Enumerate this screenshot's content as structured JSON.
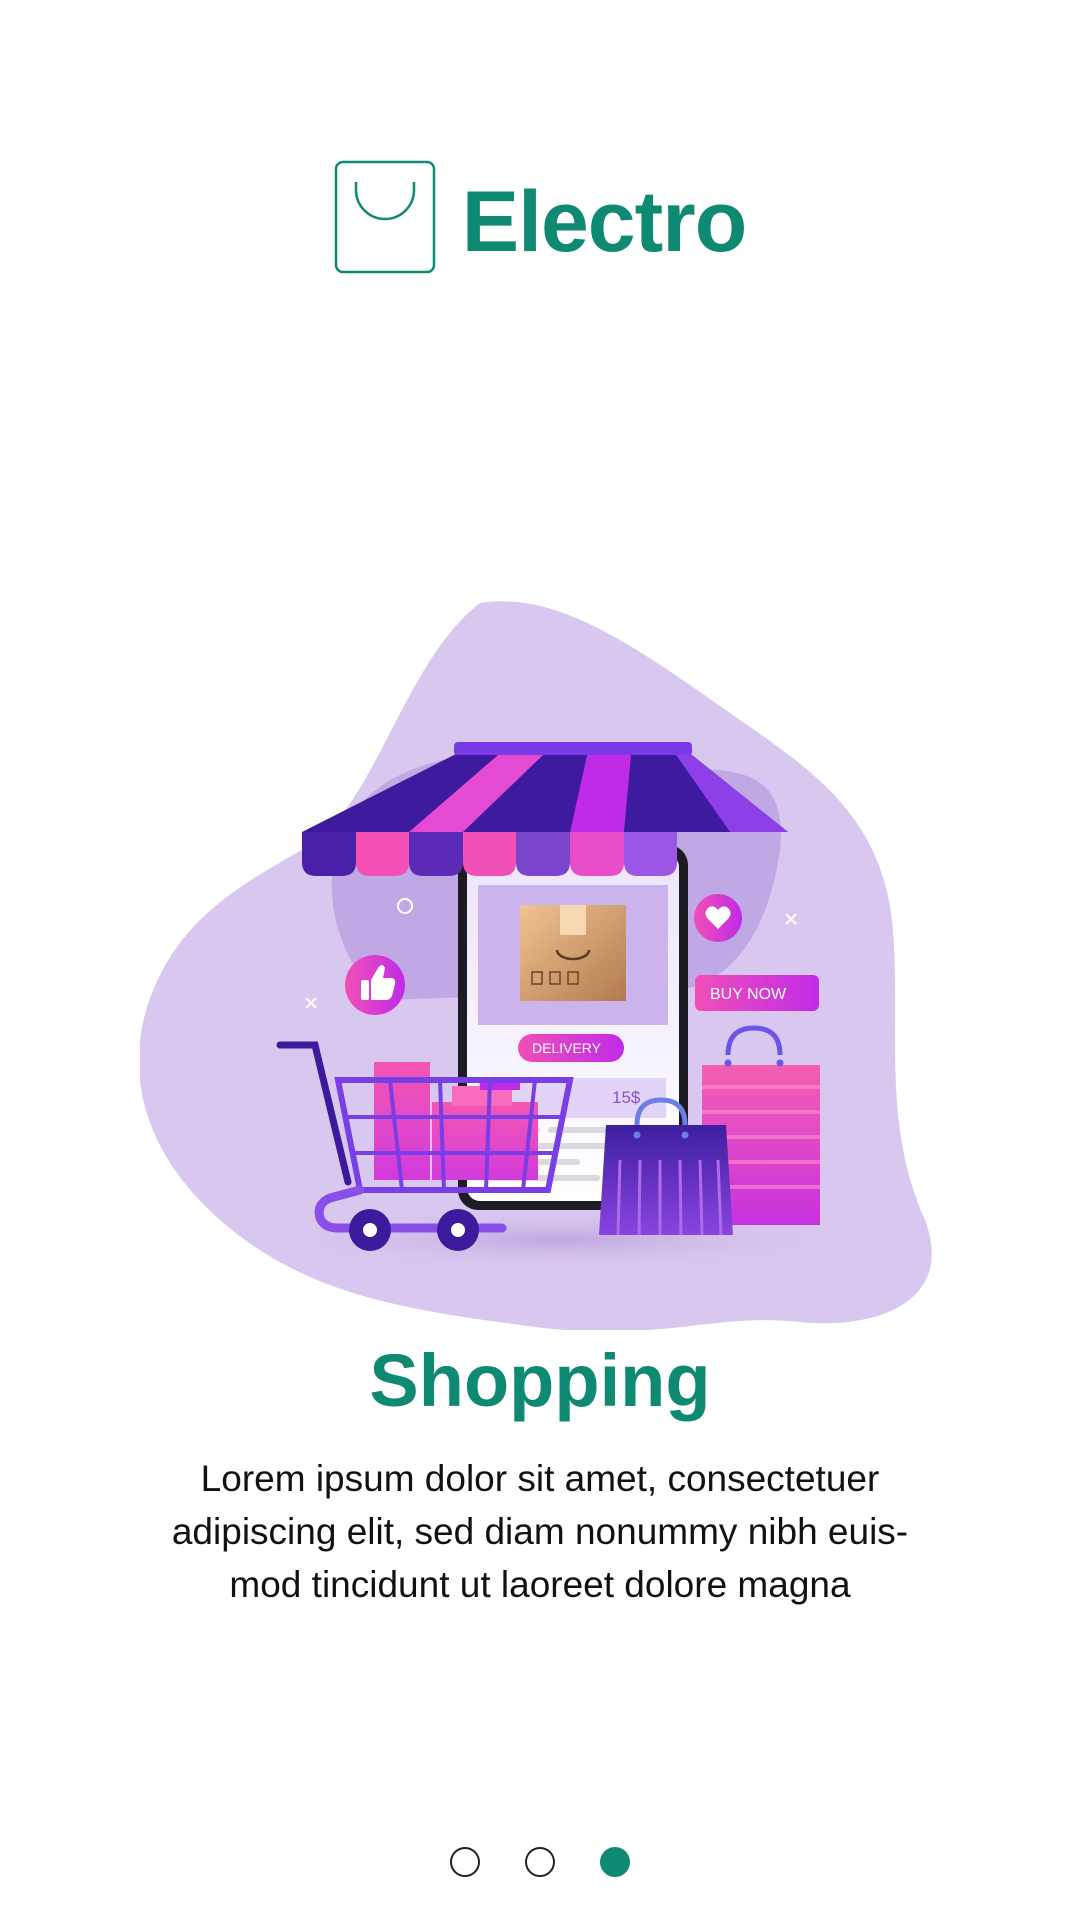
{
  "brand": {
    "name": "Electro",
    "logo_icon": "shopping-bag-outline-icon"
  },
  "hero": {
    "buy_now_label": "BUY NOW",
    "delivery_label": "DELIVERY",
    "price_label": "15$",
    "icons": [
      "store-awning-icon",
      "smartphone-icon",
      "parcel-box-icon",
      "thumbs-up-icon",
      "heart-icon",
      "shopping-cart-icon",
      "shopping-bag-icon"
    ]
  },
  "onboarding": {
    "title": "Shopping",
    "description": "Lorem ipsum dolor sit amet, consectetuer adipiscing elit, sed diam nonummy nibh euis-mod tincidunt ut laoreet dolore magna",
    "total_steps": 3,
    "current_step": 3
  },
  "colors": {
    "accent": "#0f8a72",
    "blob": "#d8c8ef",
    "purple_dark": "#3b1a9c",
    "pink": "#f04fb6",
    "magenta": "#c02be8"
  }
}
